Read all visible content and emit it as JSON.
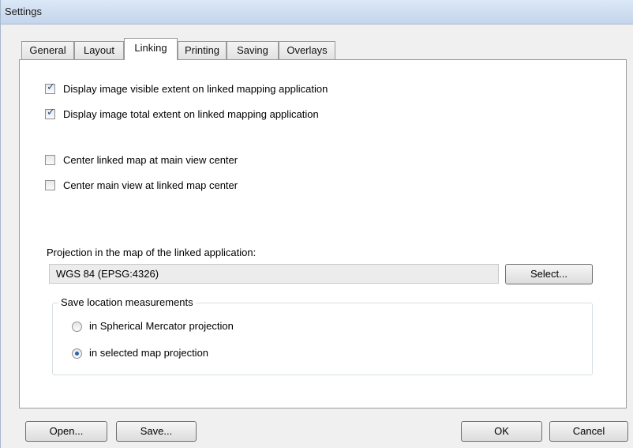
{
  "window": {
    "title": "Settings"
  },
  "tabs": [
    {
      "label": "General",
      "active": false
    },
    {
      "label": "Layout",
      "active": false
    },
    {
      "label": "Linking",
      "active": true
    },
    {
      "label": "Printing",
      "active": false
    },
    {
      "label": "Saving",
      "active": false
    },
    {
      "label": "Overlays",
      "active": false
    }
  ],
  "linking": {
    "checkboxes": [
      {
        "label": "Display image visible extent on linked mapping application",
        "checked": true
      },
      {
        "label": "Display image total extent on linked mapping application",
        "checked": true
      },
      {
        "label": "Center linked map at main view center",
        "checked": false
      },
      {
        "label": "Center main view at linked map center",
        "checked": false
      }
    ],
    "projection_label": "Projection in the map of the linked application:",
    "projection_value": "WGS 84 (EPSG:4326)",
    "select_button": "Select...",
    "save_location": {
      "title": "Save location measurements",
      "options": [
        {
          "label": "in Spherical Mercator projection",
          "selected": false
        },
        {
          "label": "in selected map projection",
          "selected": true
        }
      ]
    }
  },
  "footer": {
    "open_label": "Open...",
    "save_label": "Save...",
    "ok_label": "OK",
    "cancel_label": "Cancel"
  }
}
